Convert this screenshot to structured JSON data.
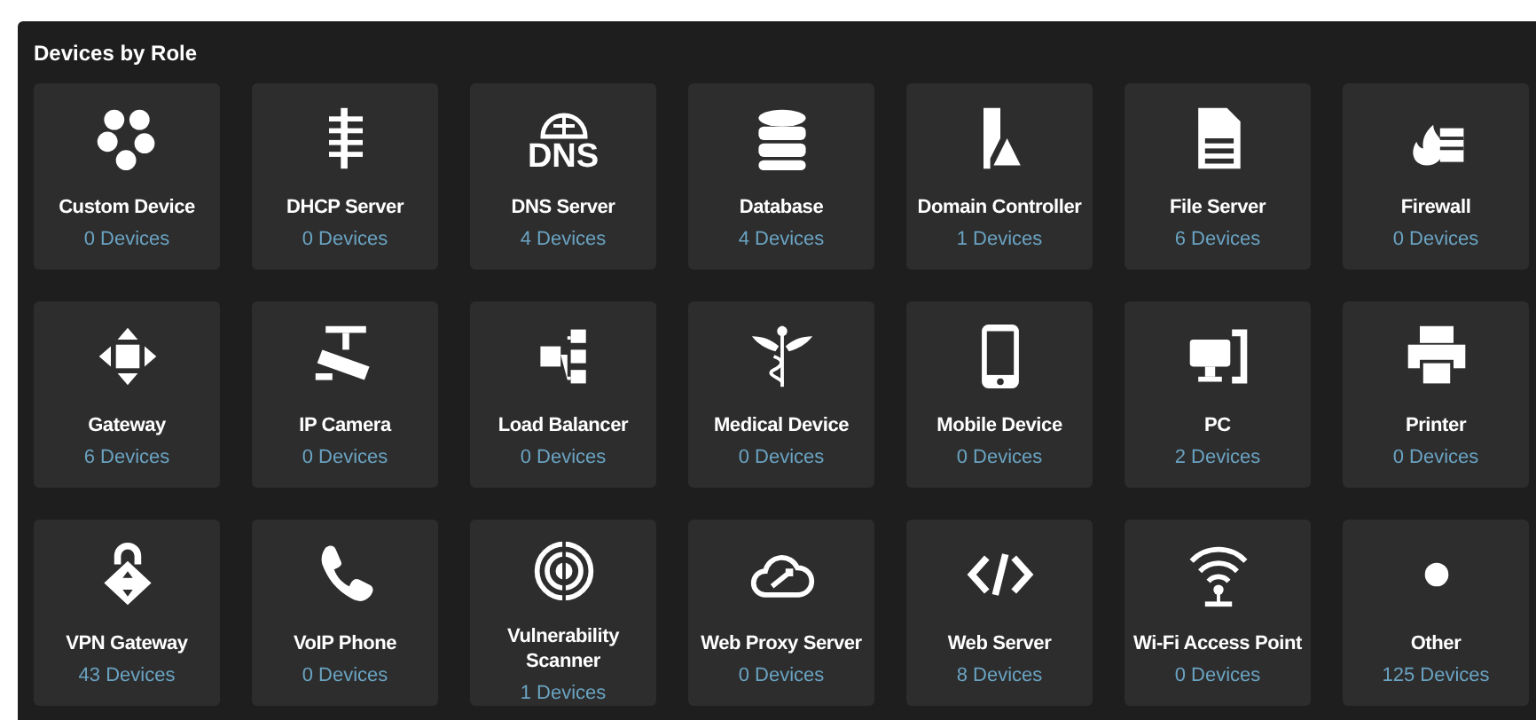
{
  "panel": {
    "title": "Devices by Role"
  },
  "roles": [
    {
      "name": "Custom Device",
      "count": "0 Devices"
    },
    {
      "name": "DHCP Server",
      "count": "0 Devices"
    },
    {
      "name": "DNS Server",
      "count": "4 Devices",
      "icon_text": "DNS"
    },
    {
      "name": "Database",
      "count": "4 Devices"
    },
    {
      "name": "Domain Controller",
      "count": "1 Devices"
    },
    {
      "name": "File Server",
      "count": "6 Devices"
    },
    {
      "name": "Firewall",
      "count": "0 Devices"
    },
    {
      "name": "Gateway",
      "count": "6 Devices"
    },
    {
      "name": "IP Camera",
      "count": "0 Devices"
    },
    {
      "name": "Load Balancer",
      "count": "0 Devices"
    },
    {
      "name": "Medical Device",
      "count": "0 Devices"
    },
    {
      "name": "Mobile Device",
      "count": "0 Devices"
    },
    {
      "name": "PC",
      "count": "2 Devices"
    },
    {
      "name": "Printer",
      "count": "0 Devices"
    },
    {
      "name": "VPN Gateway",
      "count": "43 Devices"
    },
    {
      "name": "VoIP Phone",
      "count": "0 Devices"
    },
    {
      "name": "Vulnerability Scanner",
      "count": "1 Devices"
    },
    {
      "name": "Web Proxy Server",
      "count": "0 Devices"
    },
    {
      "name": "Web Server",
      "count": "8 Devices"
    },
    {
      "name": "Wi-Fi Access Point",
      "count": "0 Devices"
    },
    {
      "name": "Other",
      "count": "125 Devices"
    }
  ]
}
